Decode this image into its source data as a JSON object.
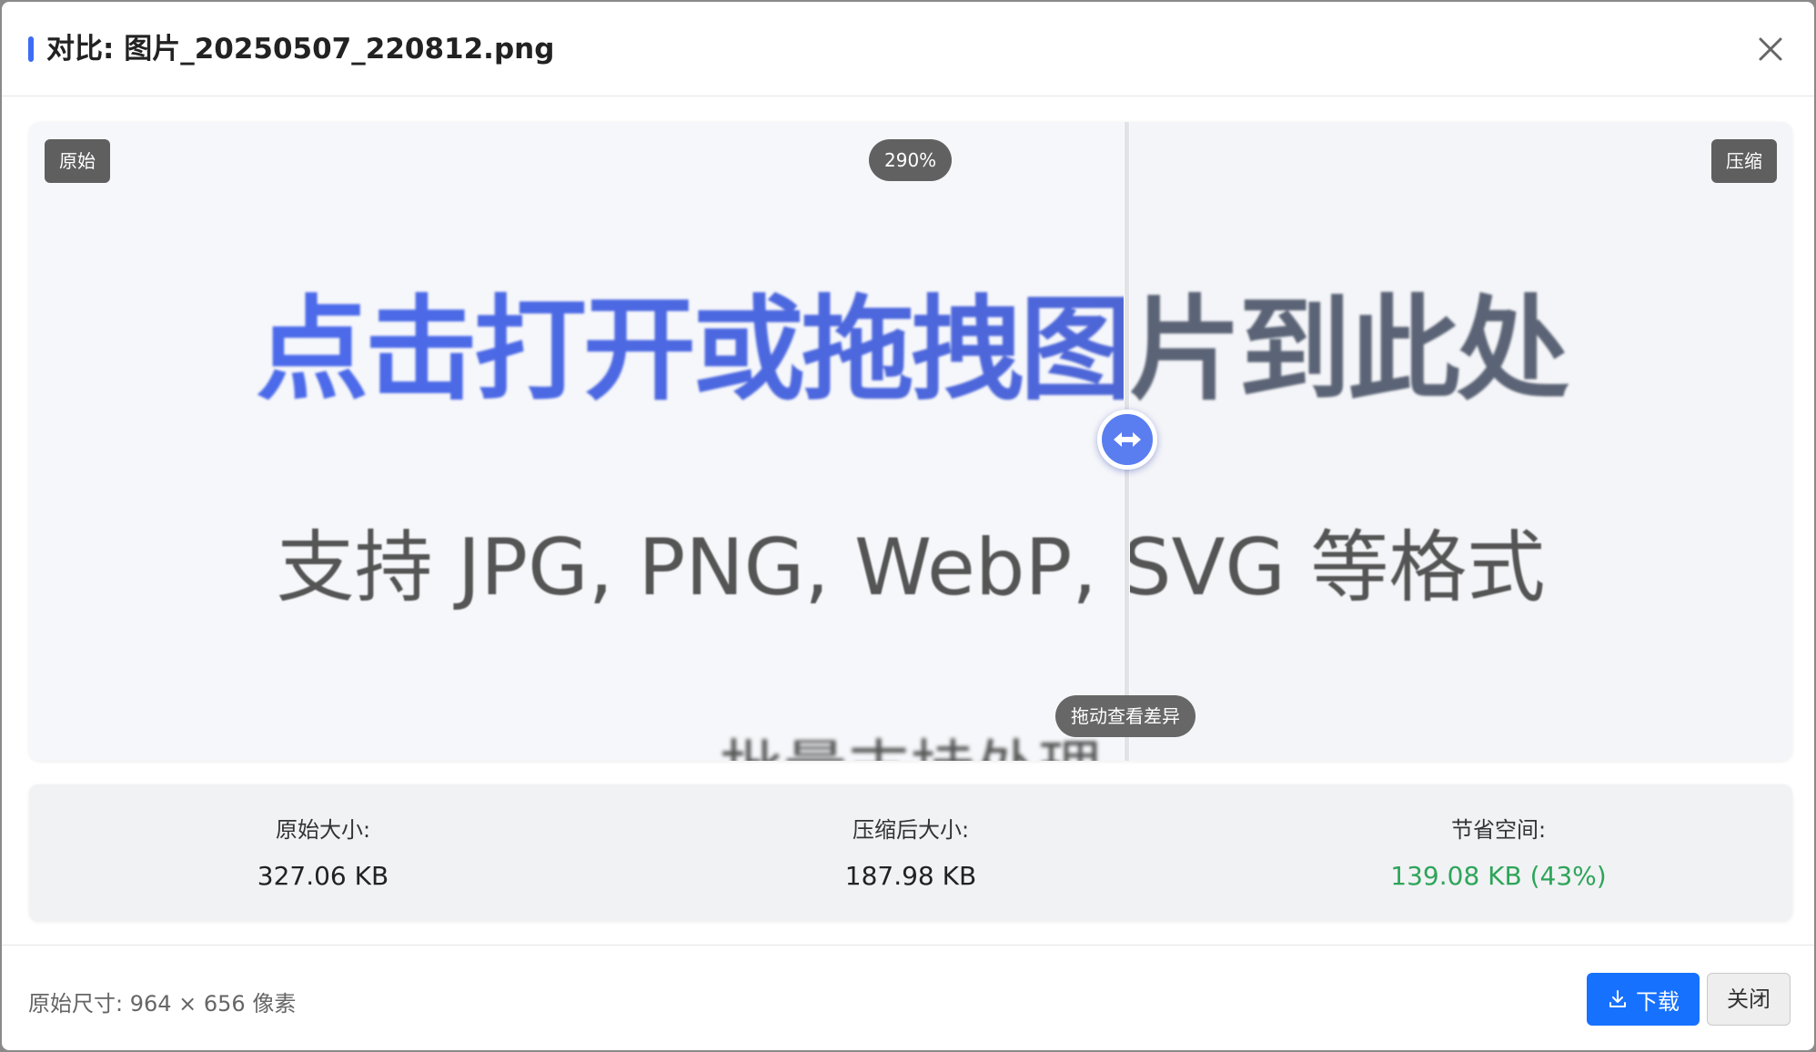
{
  "dialog": {
    "title": "对比: 图片_20250507_220812.png",
    "accent_color": "#3d6cf5"
  },
  "compare": {
    "label_original": "原始",
    "label_compressed": "压缩",
    "zoom": "290%",
    "hint": "拖动查看差异",
    "image_headline": "点击打开或拖拽图片到此处",
    "image_subline": "支持 JPG, PNG, WebP, SVG 等格式",
    "image_cutoff_line": "批量支持处理"
  },
  "stats": {
    "original_label": "原始大小:",
    "original_value": "327.06 KB",
    "compressed_label": "压缩后大小:",
    "compressed_value": "187.98 KB",
    "saved_label": "节省空间:",
    "saved_value": "139.08 KB (43%)",
    "saved_color": "#2ea55a"
  },
  "footer": {
    "dimensions": "原始尺寸: 964 × 656 像素",
    "download_label": "下载",
    "close_label": "关闭",
    "download_color": "#1671ff"
  }
}
